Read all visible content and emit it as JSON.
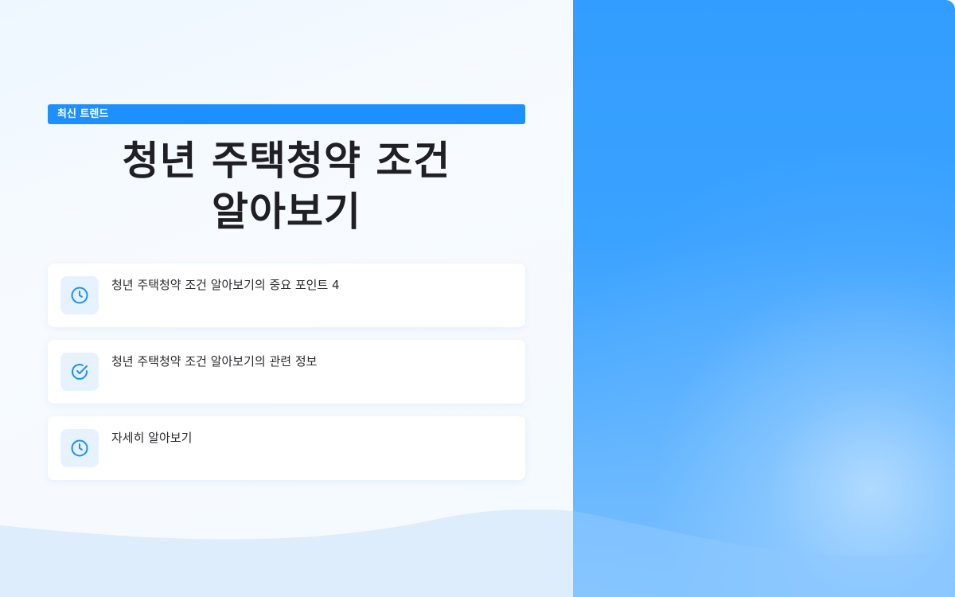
{
  "badge": {
    "label": "최신 트렌드"
  },
  "title": {
    "line1": "청년 주택청약 조건",
    "line2": "알아보기"
  },
  "cards": [
    {
      "label": "청년 주택청약 조건 알아보기의 중요 포인트 4",
      "icon": "clock-icon"
    },
    {
      "label": "청년 주택청약 조건 알아보기의 관련 정보",
      "icon": "check-circle-icon"
    },
    {
      "label": "자세히 알아보기",
      "icon": "clock-icon"
    }
  ],
  "colors": {
    "accent": "#1e8fff",
    "icon_color": "#1e8fff",
    "icon_bg": "#e6f3ff",
    "title_color": "#1f1f24",
    "panel_blue": "#339dff"
  }
}
